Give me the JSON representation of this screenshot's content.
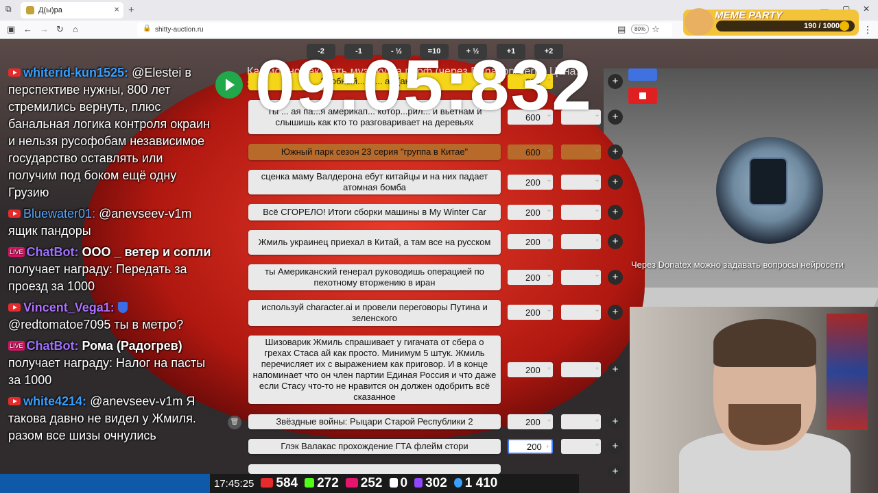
{
  "browser": {
    "tab_title": "Д(ы)ра",
    "url": "shitty-auction.ru",
    "zoom": "80%"
  },
  "chat": [
    {
      "user": "whiterid-kun1525:",
      "text": "@Elestei в перспективе нужны, 800 лет стремились вернуть, плюс банальная логика контроля окраин и нельзя русофобам независимое государство оставлять или получим под боком ещё одну Грузию"
    },
    {
      "user": "Bluewater01:",
      "text": "@anevseev-v1m ящик пандоры"
    },
    {
      "user": "ChatBot:",
      "text_bold": "ООО _ ветер и сопли",
      "text": "получает награду: Передать за проезд за 1000"
    },
    {
      "user": "Vincent_Vega1:",
      "text": "@redtomatoe7095 ты в метро?"
    },
    {
      "user": "ChatBot:",
      "text_bold": "Рома (Радогрев)",
      "text": "получает награду: Налог на пасты за 1000"
    },
    {
      "user": "white4214:",
      "text": "@anevseev-v1m Я такова давно не видел у Жмиля. разом все шизы очнулись"
    }
  ],
  "auction": {
    "timer": "09:05:832",
    "steps": [
      "-2",
      "-1",
      "- ½",
      "=10",
      "+ ½",
      "+1",
      "+2"
    ],
    "top_text": "Как можно заказать музыку на проф (через DonationAlerts) Цена... заказов в этом аук ... секунд за 3 (рубля)",
    "lots": [
      {
        "name": "Злобный...бн... ан (аним...",
        "amount": "600"
      },
      {
        "name": "Ты ... ая па...я америкап... котор...рил... и вьетнам и слышишь как кто то разговаривает на деревьях",
        "amount": "600"
      },
      {
        "name": "Южный парк сезон 23 серия \"группа в Китае\"",
        "amount": "600"
      },
      {
        "name": "сценка маму Валдерона ебут китайцы и на них падает атомная бомба",
        "amount": "200"
      },
      {
        "name": "Всё СГОРЕЛО! Итоги сборки машины в My Winter Car",
        "amount": "200"
      },
      {
        "name": "Жмиль украинец приехал в Китай, а там все на русском",
        "amount": "200"
      },
      {
        "name": "ты Американский генерал руководишь операцией по пехотному вторжению в иран",
        "amount": "200"
      },
      {
        "name": "используй character.ai и провели переговоры Путина и зеленского",
        "amount": "200"
      },
      {
        "name": "Шизоварик Жмиль спрашивает у гигачата от сбера о грехах Стаса ай как просто. Минимум 5 штук. Жмиль перечисляет их с выражением как приговор. И в конце напоминает что он член партии Единая Россия и что даже если Стасу что-то не нравится он должен одобрить всё сказанное",
        "amount": "200"
      },
      {
        "name": "Звёздные войны: Рыцари Старой Республики 2",
        "amount": "200"
      },
      {
        "name": "Глэк Валакас прохождение ГТА флейм стори",
        "amount": "200"
      }
    ]
  },
  "meme_party": {
    "title": "MEME PARTY",
    "progress": "190 / 1000"
  },
  "donatex_text": "Через Donatex можно задавать вопросы нейросети",
  "stats": {
    "time": "17:45:25",
    "youtube": "584",
    "kick": "272",
    "vklive": "252",
    "rutube": "0",
    "twitch": "302",
    "total": "1 410"
  },
  "colors": {
    "lot_default": "#e9e9ea",
    "lot_highlight": "#b86a2a",
    "lot_top": "#f5d518",
    "play_button": "#20a84a",
    "stop_button": "#e02020"
  }
}
